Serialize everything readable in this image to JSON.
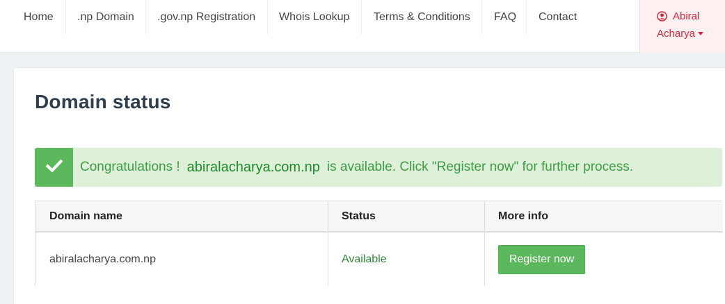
{
  "nav": {
    "items": [
      {
        "label": "Home"
      },
      {
        "label": ".np Domain"
      },
      {
        "label": ".gov.np Registration"
      },
      {
        "label": "Whois Lookup"
      },
      {
        "label": "Terms & Conditions"
      },
      {
        "label": "FAQ"
      },
      {
        "label": "Contact"
      }
    ],
    "user": {
      "first_name": "Abiral",
      "last_name": "Acharya",
      "icon": "user-circle-icon",
      "color": "#d7263d"
    }
  },
  "main": {
    "title": "Domain status",
    "alert": {
      "icon": "check-icon",
      "prefix": "Congratulations !",
      "domain": "abiralacharya.com.np",
      "suffix": "is available. Click \"Register now\" for further process.",
      "color": "#dff0d8"
    },
    "table": {
      "headers": [
        "Domain name",
        "Status",
        "More info"
      ],
      "rows": [
        {
          "domain": "abiralacharya.com.np",
          "status": "Available",
          "action_label": "Register now"
        }
      ]
    }
  }
}
